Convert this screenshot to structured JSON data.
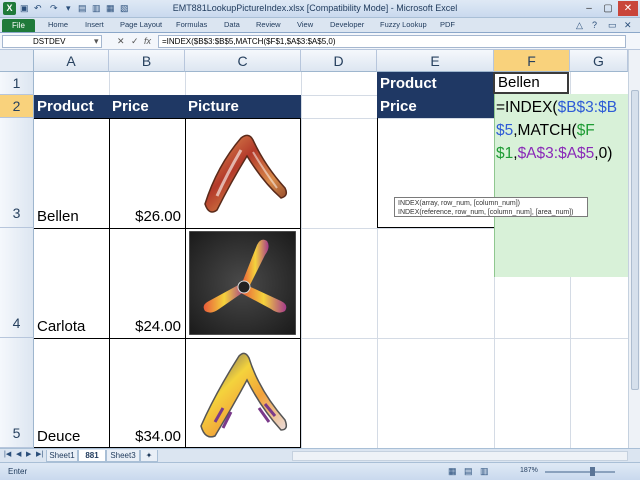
{
  "window": {
    "title": "EMT881LookupPictureIndex.xlsx  [Compatibility Mode]  -  Microsoft Excel",
    "logo": "X"
  },
  "ribbon": {
    "file_label": "File",
    "tabs": [
      "Home",
      "Insert",
      "Page Layout",
      "Formulas",
      "Data",
      "Review",
      "View",
      "Developer",
      "Fuzzy Lookup",
      "PDF"
    ]
  },
  "formula_bar": {
    "name_box": "DSTDEV",
    "cancel": "✕",
    "enter": "✓",
    "fx": "fx",
    "formula": "=INDEX($B$3:$B$5,MATCH($F$1,$A$3:$A$5,0)"
  },
  "columns": [
    "A",
    "B",
    "C",
    "D",
    "E",
    "F",
    "G"
  ],
  "rows": [
    "1",
    "2",
    "3",
    "4",
    "5"
  ],
  "table": {
    "headers": [
      "Product",
      "Price",
      "Picture"
    ],
    "rows": [
      {
        "product": "Bellen",
        "price": "$26.00"
      },
      {
        "product": "Carlota",
        "price": "$24.00"
      },
      {
        "product": "Deuce",
        "price": "$34.00"
      }
    ]
  },
  "lookup": {
    "product_label": "Product",
    "price_label": "Price",
    "product_value": "Bellen"
  },
  "editing_formula": {
    "p1": "=INDEX(",
    "p2": "$B$3:$B$5",
    "p3": ",MATCH(",
    "p4": "$F$1",
    "p5": ",",
    "p6": "$A$3:$A$5",
    "p7": ",0)"
  },
  "tooltip": {
    "line1": "INDEX(array, row_num, [column_num])",
    "line2": "INDEX(reference, row_num, [column_num], [area_num])"
  },
  "sheets": [
    "Sheet1",
    "881",
    "Sheet3"
  ],
  "active_sheet": "881",
  "status": {
    "mode": "Enter",
    "zoom": "187%"
  },
  "colors": {
    "header_fill": "#1f3864",
    "edit_highlight": "#d8f1d8",
    "ref_blue": "#2e5bd6",
    "ref_green": "#1e9c34",
    "ref_purple": "#8a2ab8",
    "excel_green": "#1f7a3a"
  }
}
